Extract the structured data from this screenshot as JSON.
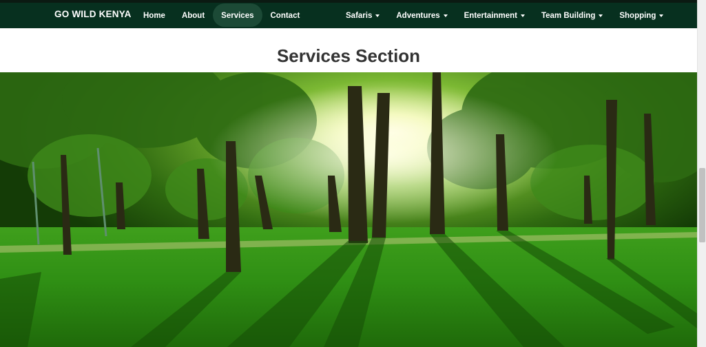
{
  "navbar": {
    "brand": "GO WILD KENYA",
    "left_items": [
      {
        "label": "Home"
      },
      {
        "label": "About"
      },
      {
        "label": "Services",
        "active": true
      },
      {
        "label": "Contact"
      }
    ],
    "right_items": [
      {
        "label": "Safaris"
      },
      {
        "label": "Adventures"
      },
      {
        "label": "Entertainment"
      },
      {
        "label": "Team Building"
      },
      {
        "label": "Shopping"
      }
    ],
    "colors": {
      "background": "#07301f",
      "active_pill": "#1c4a36",
      "text": "#ffffff"
    }
  },
  "section": {
    "title": "Services Section"
  },
  "hero": {
    "image": "sunlit-park-forest-photo",
    "colors": {
      "sky": "#eaf5c0",
      "grass": "#2f8f14",
      "canopy": "#2f6a10"
    }
  },
  "icons": [
    "chevron-down-icon"
  ]
}
